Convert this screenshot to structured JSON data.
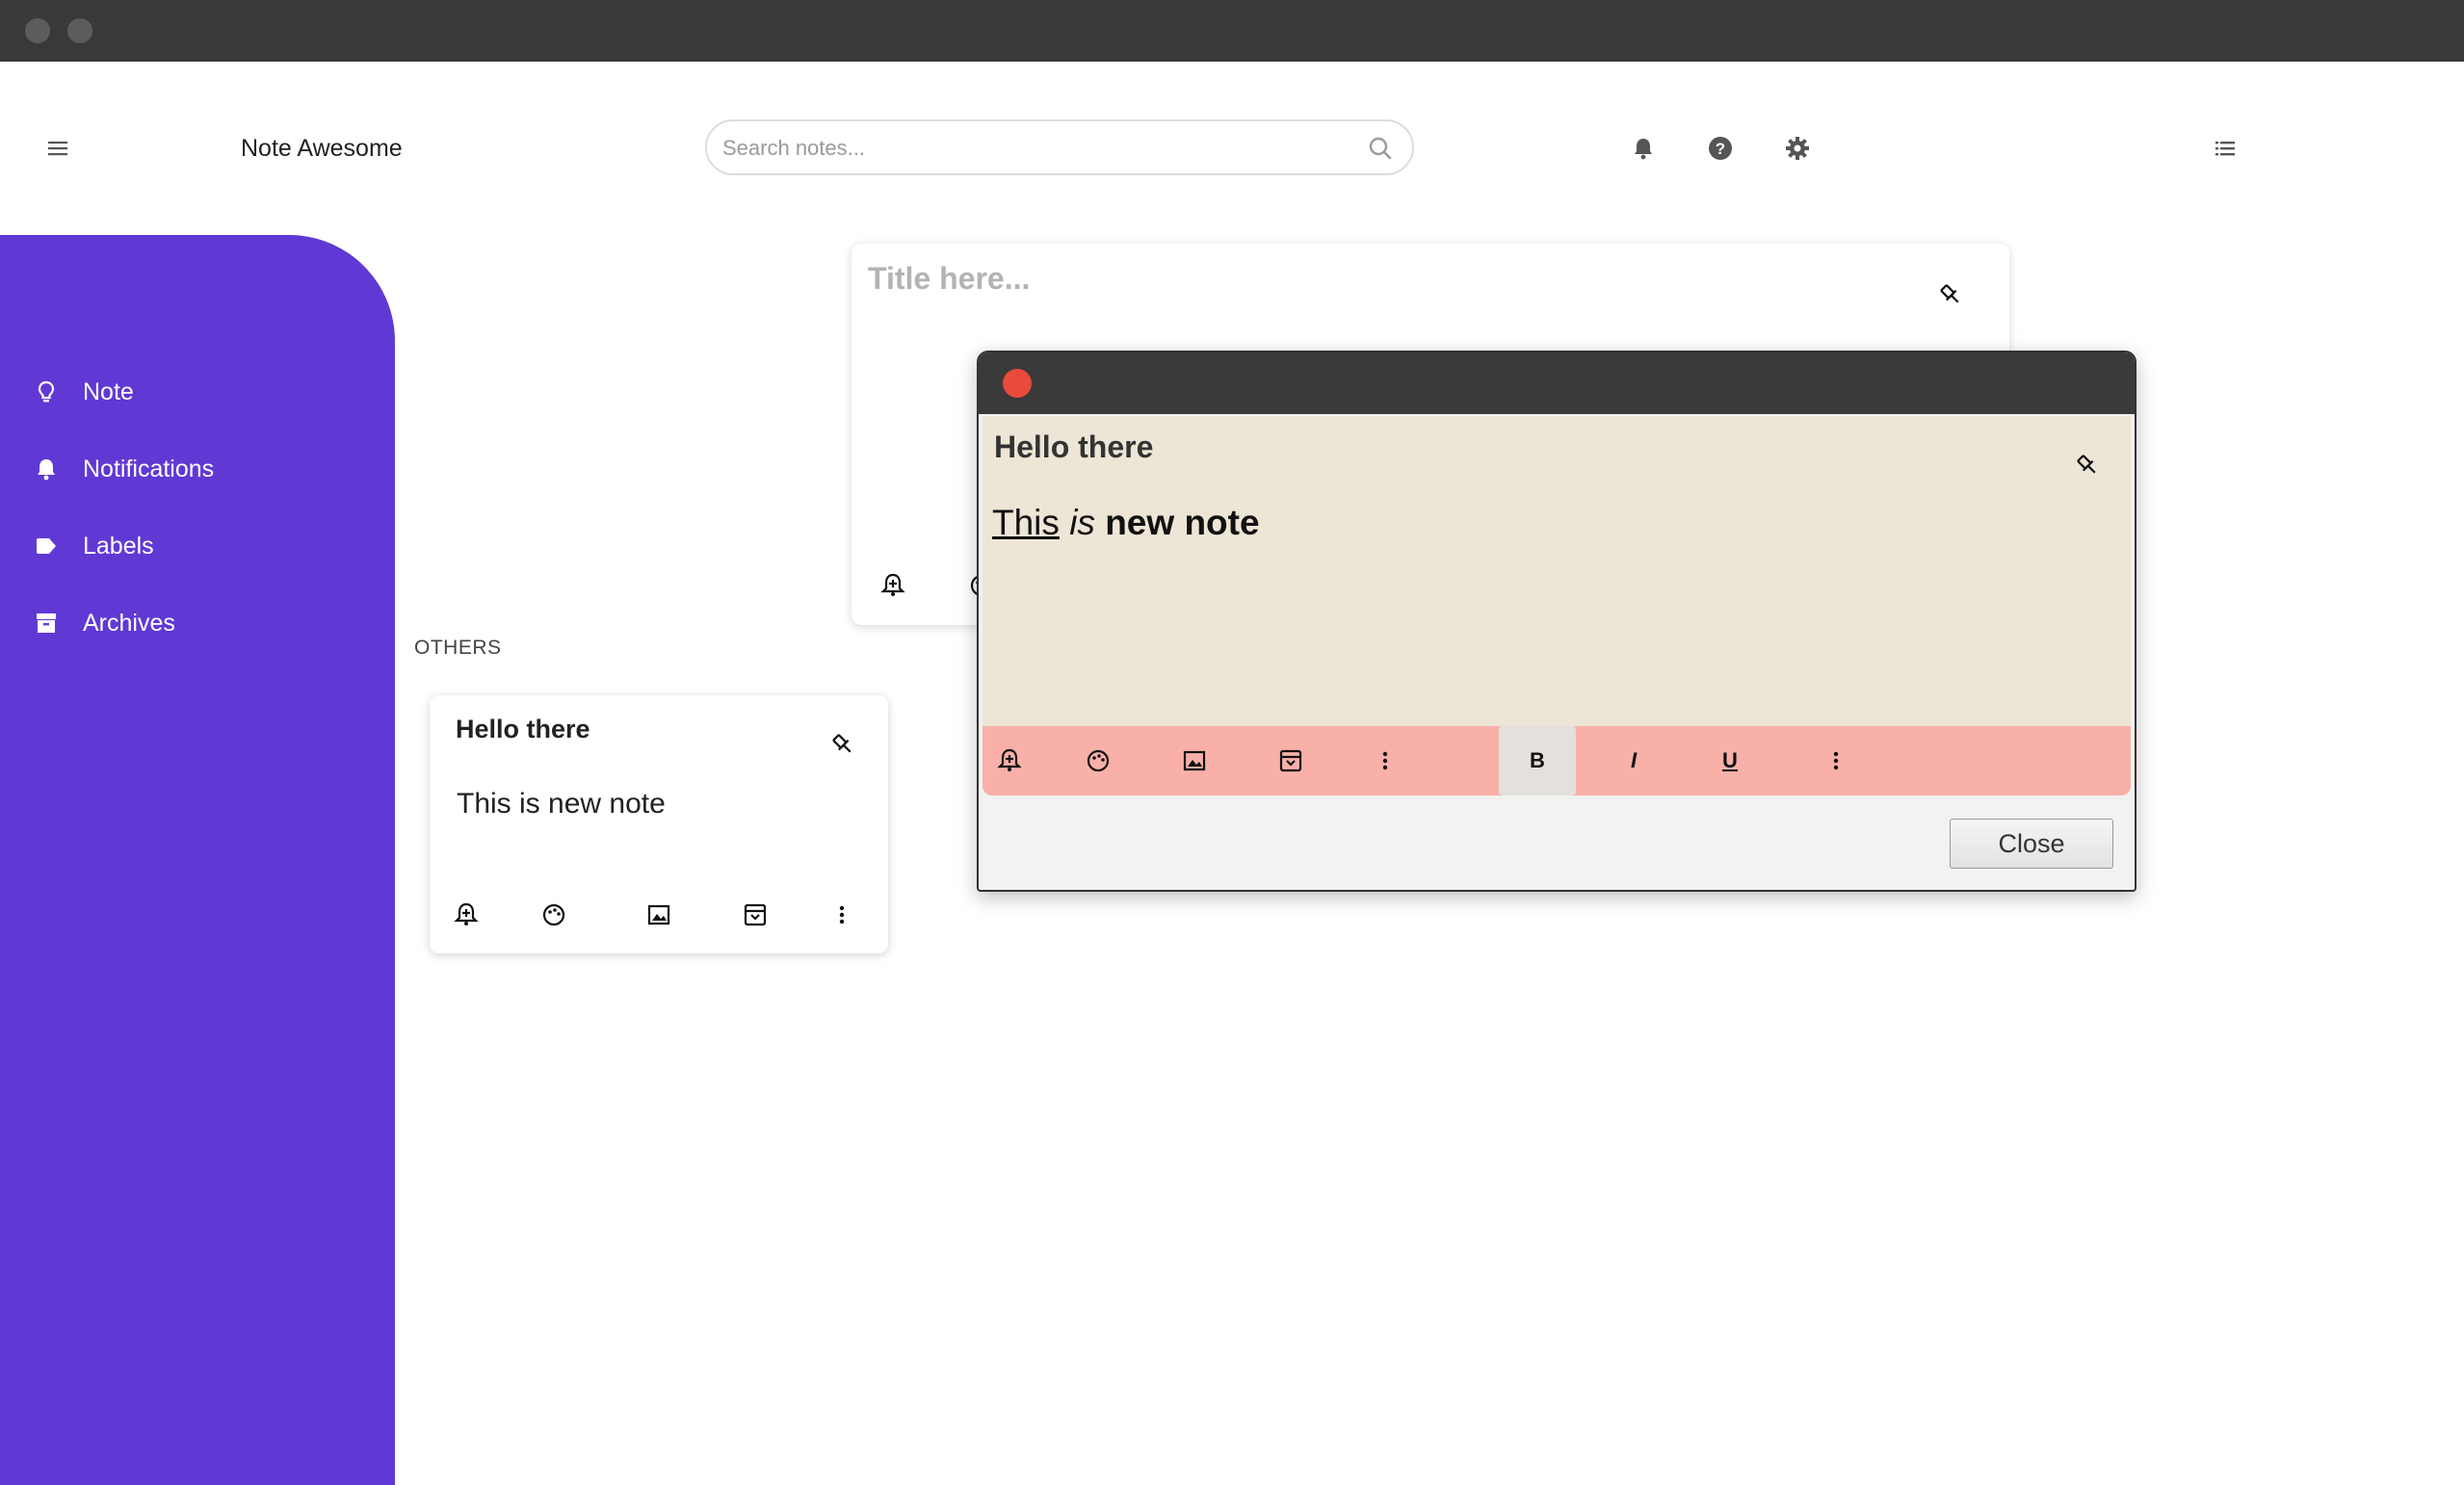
{
  "header": {
    "app_title": "Note Awesome",
    "search_placeholder": "Search notes...",
    "icons": [
      "menu-icon",
      "search-icon",
      "bell-icon",
      "help-icon",
      "gear-icon",
      "list-view-icon"
    ]
  },
  "sidebar": {
    "color": "#6039d4",
    "items": [
      {
        "label": "Note",
        "icon": "lightbulb-icon"
      },
      {
        "label": "Notifications",
        "icon": "bell-icon"
      },
      {
        "label": "Labels",
        "icon": "label-icon"
      },
      {
        "label": "Archives",
        "icon": "archive-icon"
      }
    ]
  },
  "composer": {
    "title_placeholder": "Title here..."
  },
  "others": {
    "section_label": "OTHERS",
    "notes": [
      {
        "title": "Hello there",
        "body": "This is new note"
      }
    ]
  },
  "dialog": {
    "title": "Hello there",
    "body_parts": {
      "underlined": "This",
      "italic": "is",
      "bold": "new note"
    },
    "format_buttons": {
      "bold": "B",
      "italic": "I",
      "underline": "U"
    },
    "close_label": "Close",
    "colors": {
      "body_bg": "#ede5d6",
      "toolbar_bg": "#f8b0a8",
      "close_dot": "#e84a3b"
    }
  }
}
